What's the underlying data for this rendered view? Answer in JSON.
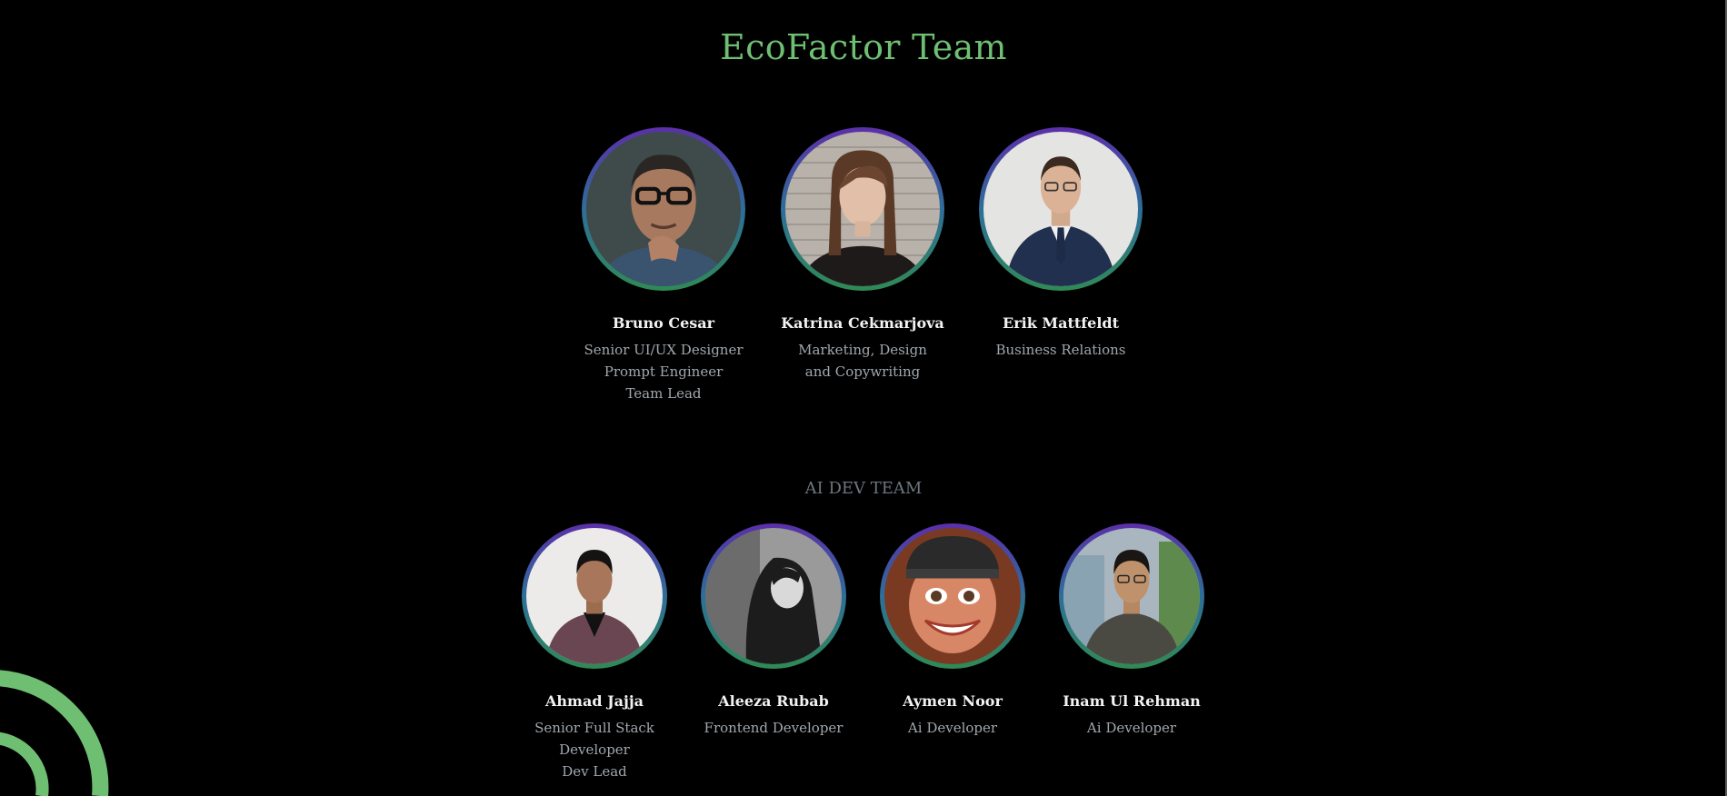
{
  "page": {
    "title": "EcoFactor Team",
    "subtitle": "AI DEV TEAM"
  },
  "leadership": [
    {
      "name": "Bruno Cesar",
      "role_lines": [
        "Senior UI/UX Designer",
        "Prompt Engineer",
        "Team Lead"
      ],
      "photo": "man-glasses-hand-on-chin"
    },
    {
      "name": "Katrina Cekmarjova",
      "role_lines": [
        "Marketing, Design",
        "and Copywriting"
      ],
      "photo": "woman-brick-wall"
    },
    {
      "name": "Erik Mattfeldt",
      "role_lines": [
        "Business Relations"
      ],
      "photo": "man-suit-arms-crossed"
    }
  ],
  "dev_team": [
    {
      "name": "Ahmad Jajja",
      "role_lines": [
        "Senior Full Stack",
        "Developer",
        "Dev Lead"
      ],
      "photo": "man-maroon-blazer"
    },
    {
      "name": "Aleeza Rubab",
      "role_lines": [
        "Frontend Developer"
      ],
      "photo": "woman-black-and-white"
    },
    {
      "name": "Aymen Noor",
      "role_lines": [
        "Ai Developer"
      ],
      "photo": "cartoon-woman-cap"
    },
    {
      "name": "Inam Ul Rehman",
      "role_lines": [
        "Ai Developer"
      ],
      "photo": "man-glasses-grey-shirt"
    }
  ],
  "colors": {
    "title": "#6fbf73",
    "ring_top": "#5b2fa8",
    "ring_bottom": "#2f8a55",
    "decor_arc": "#6fbf73"
  }
}
